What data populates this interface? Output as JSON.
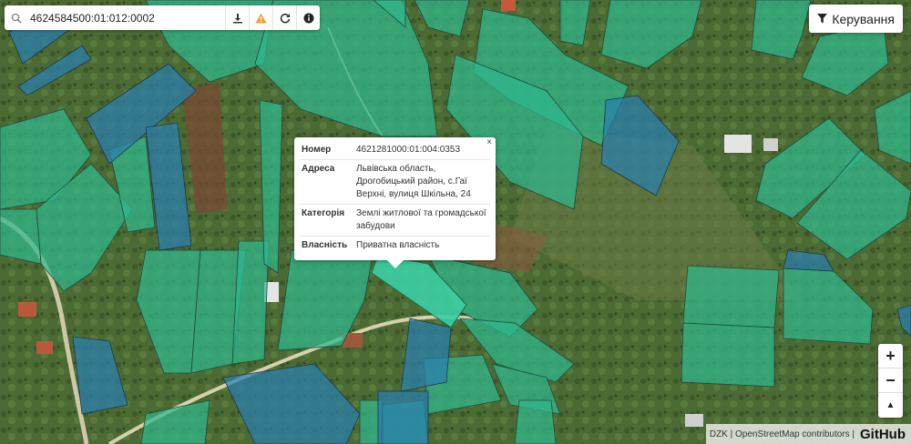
{
  "search": {
    "value": "4624584500:01:012:0002",
    "icon": "search-icon"
  },
  "toolbar": {
    "download_icon": "download-icon",
    "warning_icon": "warning-icon",
    "refresh_icon": "refresh-icon",
    "info_icon": "info-icon"
  },
  "control": {
    "label": "Керування",
    "icon": "filter-icon"
  },
  "popup": {
    "close_label": "×",
    "rows": [
      {
        "key": "Номер",
        "value": "4621281000:01:004:0353"
      },
      {
        "key": "Адреса",
        "value": "Львівська область, Дрогобицький район, с.Гаї Верхні, вулиця Шкільна, 24"
      },
      {
        "key": "Категорія",
        "value": "Землі житлової та громадської забудови"
      },
      {
        "key": "Власність",
        "value": "Приватна власність"
      }
    ]
  },
  "zoom": {
    "in_label": "+",
    "out_label": "−",
    "north_label": "▲"
  },
  "attribution": {
    "text": "DZK | OpenStreetMap contributors |",
    "github": "GitHub"
  },
  "colors": {
    "private_parcel": "#2fb98d",
    "other_parcel": "#2a7fb0",
    "selected_parcel": "#3ccfa4"
  }
}
